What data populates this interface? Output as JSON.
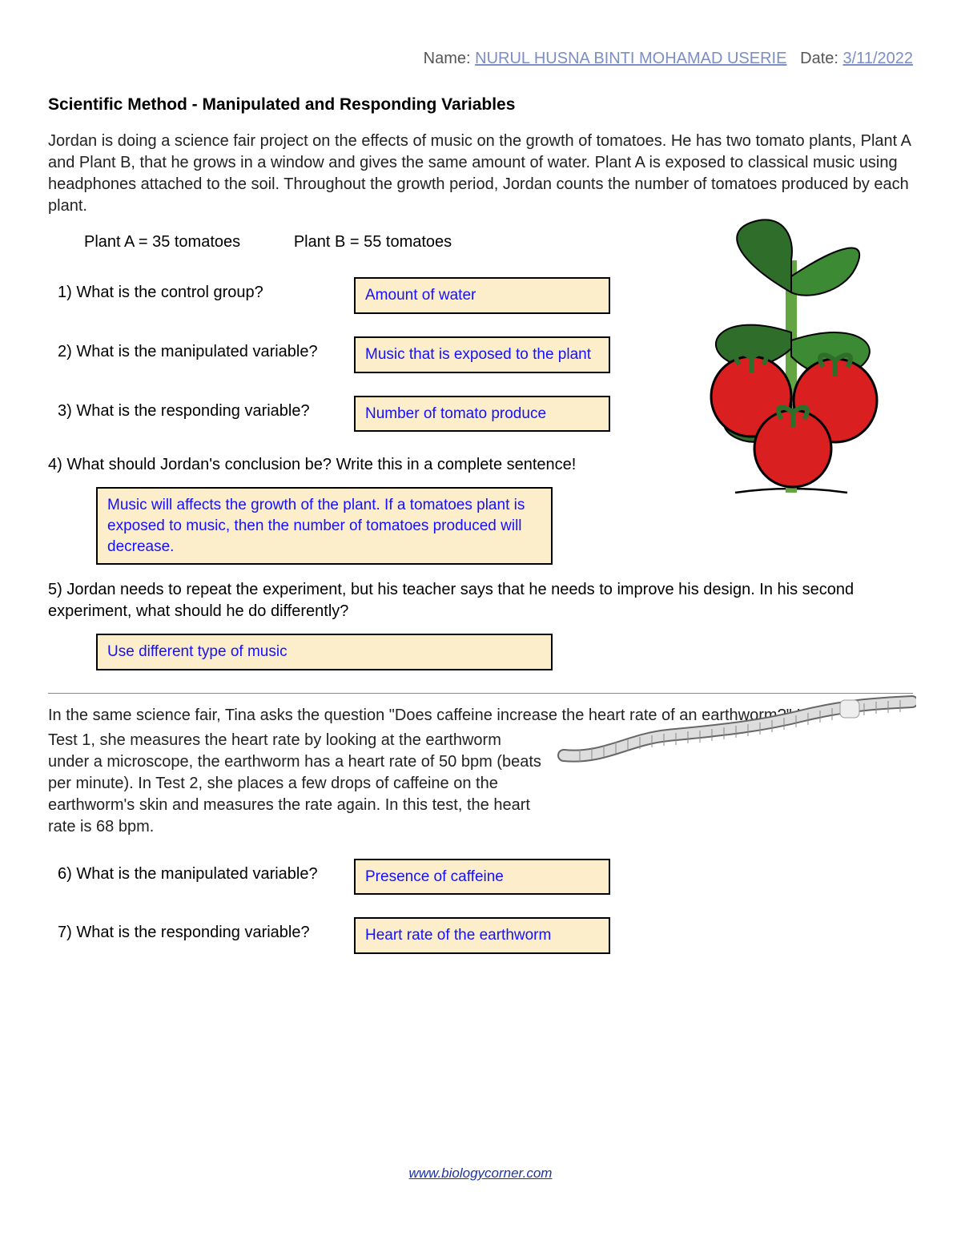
{
  "header": {
    "name_label": "Name:",
    "name_value": "NURUL HUSNA BINTI MOHAMAD USERIE",
    "date_label": "Date:",
    "date_value": "3/11/2022"
  },
  "title": "Scientific Method - Manipulated and Responding Variables",
  "intro": "Jordan is doing a science fair project on the effects of music on the growth of tomatoes.  He has two tomato plants, Plant A and Plant B, that he grows in a window and gives the same amount of water.   Plant A is exposed to classical music using headphones attached to the soil.   Throughout the growth period, Jordan counts the number of tomatoes produced by each plant.",
  "results": {
    "plant_a": "Plant A =  35 tomatoes",
    "plant_b": "Plant B   =  55 tomatoes"
  },
  "questions": {
    "q1": {
      "label": "1)  What is the control group?",
      "answer": "Amount of water"
    },
    "q2": {
      "label": "2)  What is the manipulated variable?",
      "answer": "Music that is exposed to the plant"
    },
    "q3": {
      "label": "3)  What is the responding variable?",
      "answer": "Number of tomato produce"
    },
    "q4": {
      "label": "4)  What should Jordan's conclusion be?   Write this in a complete sentence!",
      "answer": "Music will affects the growth of the plant. If a tomatoes plant is exposed to music, then the number of tomatoes produced will decrease."
    },
    "q5": {
      "label": "5)  Jordan needs to repeat the experiment, but his teacher says that he needs to improve his design.  In his second experiment, what should he do differently?",
      "answer": "Use different type of music"
    }
  },
  "section2": {
    "first_line": "In the same science fair, Tina asks the question \"Does caffeine increase the heart rate of an earthworm?\"    In",
    "rest": "Test 1, she measures the heart rate by looking at the earthworm under a microscope, the earthworm has a heart rate of 50 bpm (beats per minute).  In Test 2, she places a few drops of caffeine on the earthworm's skin and measures the rate again.   In this test, the heart rate is 68 bpm."
  },
  "questions2": {
    "q6": {
      "label": "6)  What is the manipulated variable?",
      "answer": "Presence of caffeine"
    },
    "q7": {
      "label": "7)  What is the responding variable?",
      "answer": "Heart rate of the earthworm"
    }
  },
  "footer": {
    "url": "www.biologycorner.com"
  }
}
